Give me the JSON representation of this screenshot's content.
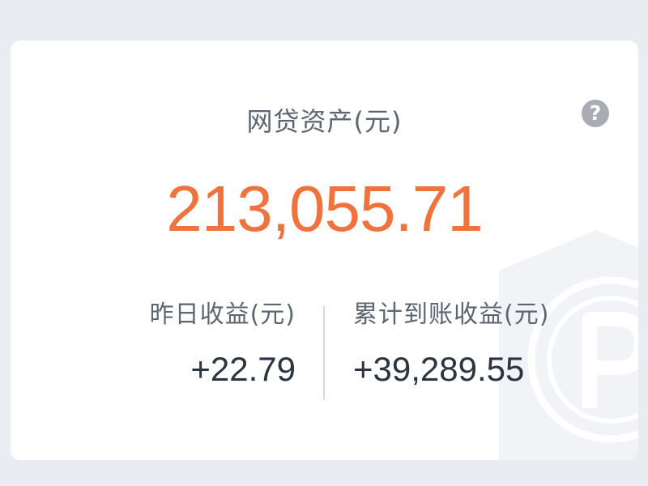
{
  "card": {
    "help_label": "?",
    "asset_label": "网贷资产(元)",
    "asset_value": "213,055.71",
    "yesterday_label": "昨日收益(元)",
    "yesterday_value": "+22.79",
    "cumulative_label": "累计到账收益(元)",
    "cumulative_value": "+39,289.55",
    "watermark_icon": "shield-p-icon"
  },
  "colors": {
    "page_bg": "#e9edf1",
    "card_bg": "#ffffff",
    "accent": "#f0733d",
    "label_text": "#5d6670",
    "value_text": "#2b3440",
    "help_bg": "#a9adb3"
  }
}
